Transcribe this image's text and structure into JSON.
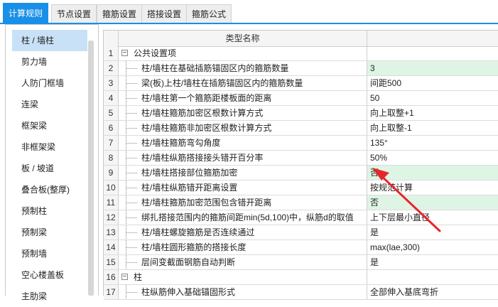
{
  "tabs": [
    {
      "label": "计算规则",
      "active": true
    },
    {
      "label": "节点设置",
      "active": false
    },
    {
      "label": "箍筋设置",
      "active": false
    },
    {
      "label": "搭接设置",
      "active": false
    },
    {
      "label": "箍筋公式",
      "active": false
    }
  ],
  "sidebar": {
    "items": [
      {
        "label": "柱 / 墙柱",
        "selected": true
      },
      {
        "label": "剪力墙"
      },
      {
        "label": "人防门框墙"
      },
      {
        "label": "连梁"
      },
      {
        "label": "框架梁"
      },
      {
        "label": "非框架梁"
      },
      {
        "label": "板 / 坡道"
      },
      {
        "label": "叠合板(整厚)"
      },
      {
        "label": "预制柱"
      },
      {
        "label": "预制梁"
      },
      {
        "label": "预制墙"
      },
      {
        "label": "空心楼盖板"
      },
      {
        "label": "主肋梁"
      }
    ]
  },
  "table": {
    "header": {
      "name": "类型名称",
      "value": ""
    },
    "rows": [
      {
        "num": "1",
        "name": "公共设置项",
        "value": "",
        "group": true,
        "expander": "−"
      },
      {
        "num": "2",
        "name": "柱/墙柱在基础插筋锚固区内的箍筋数量",
        "value": "3",
        "green": true
      },
      {
        "num": "3",
        "name": "梁(板)上柱/墙柱在插筋锚固区内的箍筋数量",
        "value": "间距500"
      },
      {
        "num": "4",
        "name": "柱/墙柱第一个箍筋距楼板面的距离",
        "value": "50"
      },
      {
        "num": "5",
        "name": "柱/墙柱箍筋加密区根数计算方式",
        "value": "向上取整+1"
      },
      {
        "num": "6",
        "name": "柱/墙柱箍筋非加密区根数计算方式",
        "value": "向上取整-1"
      },
      {
        "num": "7",
        "name": "柱/墙柱箍筋弯勾角度",
        "value": "135°"
      },
      {
        "num": "8",
        "name": "柱/墙柱纵筋搭接接头错开百分率",
        "value": "50%"
      },
      {
        "num": "9",
        "name": "柱/墙柱搭接部位箍筋加密",
        "value": "否",
        "green": true
      },
      {
        "num": "10",
        "name": "柱/墙柱纵筋错开距离设置",
        "value": "按规范计算"
      },
      {
        "num": "11",
        "name": "柱/墙柱箍筋加密范围包含错开距离",
        "value": "否",
        "green": true
      },
      {
        "num": "12",
        "name": "绑扎搭接范围内的箍筋间距min(5d,100)中，纵筋d的取值",
        "value": "上下层最小直径"
      },
      {
        "num": "13",
        "name": "柱/墙柱螺旋箍筋是否连续通过",
        "value": "是"
      },
      {
        "num": "14",
        "name": "柱/墙柱圆形箍筋的搭接长度",
        "value": "max(lae,300)"
      },
      {
        "num": "15",
        "name": "层间变截面钢筋自动判断",
        "value": "是"
      },
      {
        "num": "16",
        "name": "柱",
        "value": "",
        "group": true,
        "expander": "−"
      },
      {
        "num": "17",
        "name": "柱纵筋伸入基础锚固形式",
        "value": "全部伸入基底弯折"
      }
    ]
  },
  "colors": {
    "accent": "#1890e8",
    "selected_row": "#c8e1f6",
    "green_cell": "#def5e6",
    "arrow": "#e8262a"
  }
}
